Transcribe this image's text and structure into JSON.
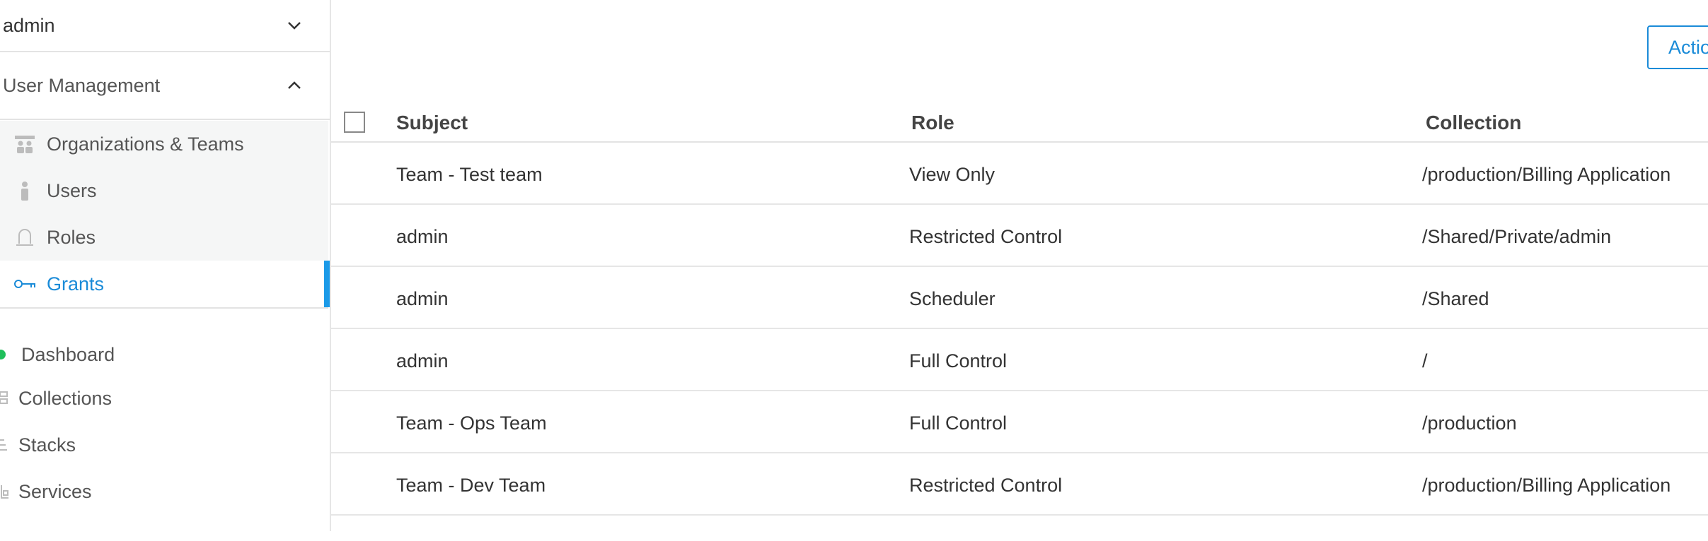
{
  "sidebar": {
    "user_menu": {
      "label": "admin"
    },
    "user_management": {
      "label": "User Management"
    },
    "sub_items": [
      {
        "label": "Organizations & Teams",
        "icon": "organizations-icon"
      },
      {
        "label": "Users",
        "icon": "user-icon"
      },
      {
        "label": "Roles",
        "icon": "roles-icon"
      }
    ],
    "active_item": {
      "label": "Grants",
      "icon": "key-icon"
    },
    "nav_items": [
      {
        "label": "Dashboard",
        "icon": "dashboard-dot-icon"
      },
      {
        "label": "Collections",
        "icon": "collections-icon"
      },
      {
        "label": "Stacks",
        "icon": "stacks-icon"
      },
      {
        "label": "Services",
        "icon": "services-icon"
      }
    ]
  },
  "toolbar": {
    "actions_label": "Actio"
  },
  "table": {
    "headers": {
      "subject": "Subject",
      "role": "Role",
      "collection": "Collection"
    },
    "rows": [
      {
        "subject": "Team - Test team",
        "role": "View Only",
        "collection": "/production/Billing Application"
      },
      {
        "subject": "admin",
        "role": "Restricted Control",
        "collection": "/Shared/Private/admin"
      },
      {
        "subject": "admin",
        "role": "Scheduler",
        "collection": "/Shared"
      },
      {
        "subject": "admin",
        "role": "Full Control",
        "collection": "/"
      },
      {
        "subject": "Team - Ops Team",
        "role": "Full Control",
        "collection": "/production"
      },
      {
        "subject": "Team - Dev Team",
        "role": "Restricted Control",
        "collection": "/production/Billing Application"
      }
    ]
  },
  "colors": {
    "accent": "#1a8bd8",
    "active_bar": "#1b9ae8",
    "status_green": "#1fbf5b"
  }
}
